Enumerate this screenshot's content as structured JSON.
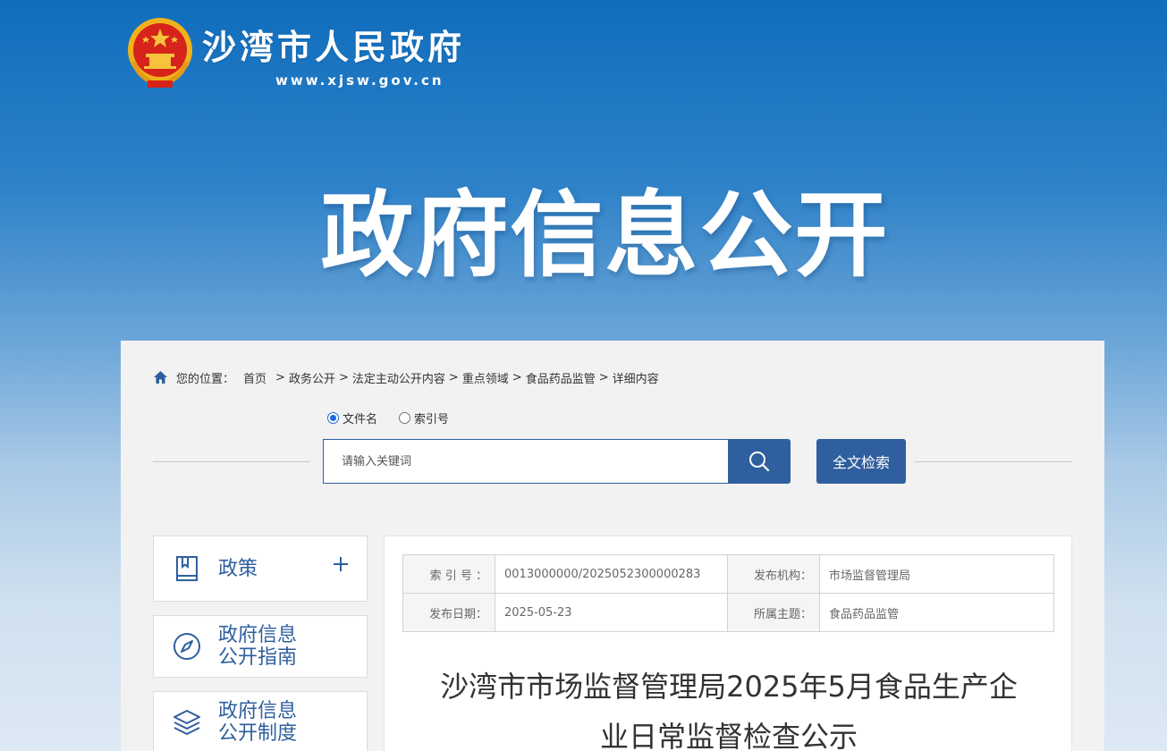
{
  "header": {
    "site_title": "沙湾市人民政府",
    "site_url": "www.xjsw.gov.cn",
    "banner_title": "政府信息公开"
  },
  "breadcrumb": {
    "label": "您的位置：",
    "items": [
      "首页",
      "政务公开",
      "法定主动公开内容",
      "重点领域",
      "食品药品监管",
      "详细内容"
    ],
    "separator": ">"
  },
  "search": {
    "radio_options": [
      "文件名",
      "索引号"
    ],
    "selected": "文件名",
    "placeholder": "请输入关键词",
    "fulltext_label": "全文检索"
  },
  "sidebar": {
    "items": [
      {
        "label": "政策",
        "icon": "book-icon",
        "expandable": true
      },
      {
        "label_line1": "政府信息",
        "label_line2": "公开指南",
        "icon": "compass-icon"
      },
      {
        "label_line1": "政府信息",
        "label_line2": "公开制度",
        "icon": "layers-icon"
      }
    ]
  },
  "meta": {
    "index_label": "索 引 号 ：",
    "index_value": "0013000000/2025052300000283",
    "org_label": "发布机构：",
    "org_value": "市场监督管理局",
    "date_label": "发布日期：",
    "date_value": "2025-05-23",
    "topic_label": "所属主题：",
    "topic_value": "食品药品监管"
  },
  "article": {
    "title_line1": "沙湾市市场监督管理局2025年5月食品生产企",
    "title_line2": "业日常监督检查公示"
  },
  "colors": {
    "primary": "#2f5f9e",
    "header_top": "#0f6dbd"
  }
}
